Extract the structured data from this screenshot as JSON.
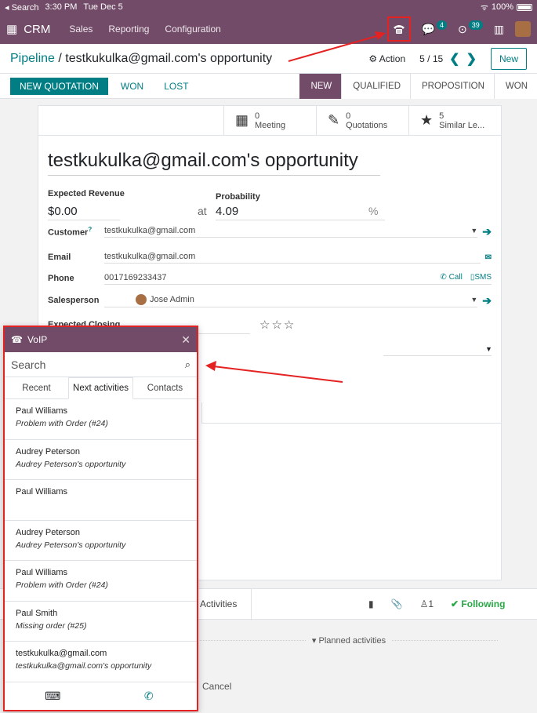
{
  "status_bar": {
    "back_label": "Search",
    "time": "3:30 PM",
    "date": "Tue Dec 5",
    "battery": "100%"
  },
  "navbar": {
    "app": "CRM",
    "menus": [
      "Sales",
      "Reporting",
      "Configuration"
    ],
    "messages_badge": "4",
    "activities_badge": "39"
  },
  "control_panel": {
    "breadcrumb_root": "Pipeline",
    "breadcrumb_sep": "/",
    "record": "testkukulka@gmail.com's opportunity",
    "action_label": "Action",
    "pager": "5 / 15",
    "new_label": "New"
  },
  "statusbar_row": {
    "new_quotation": "NEW QUOTATION",
    "won": "WON",
    "lost": "LOST",
    "stages": [
      "NEW",
      "QUALIFIED",
      "PROPOSITION",
      "WON"
    ],
    "active_stage": "NEW"
  },
  "smart_buttons": [
    {
      "count": "0",
      "label": "Meeting",
      "icon": "calendar-icon"
    },
    {
      "count": "0",
      "label": "Quotations",
      "icon": "pencil-square-icon"
    },
    {
      "count": "5",
      "label": "Similar Le...",
      "icon": "star-icon"
    }
  ],
  "form": {
    "title": "testkukulka@gmail.com's opportunity",
    "expected_revenue_label": "Expected Revenue",
    "expected_revenue": "$0.00",
    "at": "at",
    "probability_label": "Probability",
    "probability": "4.09",
    "percent": "%",
    "customer_label": "Customer",
    "help_mark": "?",
    "customer": "testkukulka@gmail.com",
    "email_label": "Email",
    "email": "testkukulka@gmail.com",
    "phone_label": "Phone",
    "phone": "0017169233437",
    "call_label": "Call",
    "sms_label": "SMS",
    "salesperson_label": "Salesperson",
    "salesperson": "Jose Admin",
    "expected_closing_label": "Expected Closing"
  },
  "chatter": {
    "activities_label": "Activities",
    "followers_count": "1",
    "following_label": "Following",
    "planned_label": "Planned activities",
    "cancel_label": "Cancel"
  },
  "voip": {
    "title": "VoIP",
    "search_placeholder": "Search",
    "tabs": [
      "Recent",
      "Next activities",
      "Contacts"
    ],
    "active_tab": "Next activities",
    "items": [
      {
        "name": "Paul Williams",
        "subtitle": "Problem with Order (#24)"
      },
      {
        "name": "Audrey Peterson",
        "subtitle": "Audrey Peterson's opportunity"
      },
      {
        "name": "Paul Williams",
        "subtitle": ""
      },
      {
        "name": "Audrey Peterson",
        "subtitle": "Audrey Peterson's opportunity"
      },
      {
        "name": "Paul Williams",
        "subtitle": "Problem with Order (#24)"
      },
      {
        "name": "Paul Smith",
        "subtitle": "Missing order (#25)"
      },
      {
        "name": "testkukulka@gmail.com",
        "subtitle": "testkukulka@gmail.com's opportunity"
      }
    ]
  },
  "colors": {
    "brand": "#714b67",
    "accent": "#017e84",
    "annotation": "#e52222"
  }
}
